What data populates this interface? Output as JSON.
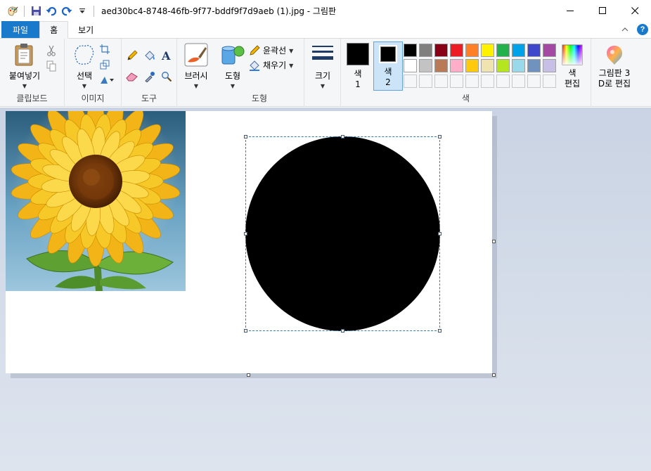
{
  "window": {
    "title": "aed30bc4-8748-46fb-9f77-bddf9f7d9aeb (1).jpg - 그림판"
  },
  "tabs": [
    {
      "label": "파일"
    },
    {
      "label": "홈"
    },
    {
      "label": "보기"
    }
  ],
  "ribbon": {
    "clipboard": {
      "paste_label": "붙여넣기",
      "group_label": "클립보드"
    },
    "image": {
      "select_label": "선택",
      "group_label": "이미지"
    },
    "tools": {
      "group_label": "도구"
    },
    "brushes": {
      "label": "브러시"
    },
    "shapes": {
      "label": "도형",
      "outline_label": "윤곽선",
      "fill_label": "채우기",
      "group_label": "도형"
    },
    "size": {
      "label": "크기"
    },
    "colors": {
      "color1_label": "색\n1",
      "color1_line1": "색",
      "color1_line2": "1",
      "color2_line1": "색",
      "color2_line2": "2",
      "edit_line1": "색",
      "edit_line2": "편집",
      "group_label": "색",
      "color1": "#000000",
      "color2": "#000000",
      "palette_row1": [
        "#000000",
        "#7f7f7f",
        "#880015",
        "#ed1c24",
        "#ff7f27",
        "#fff200",
        "#22b14c",
        "#00a2e8",
        "#3f48cc",
        "#a349a4"
      ],
      "palette_row2": [
        "#ffffff",
        "#c3c3c3",
        "#b97a57",
        "#ffaec9",
        "#ffc90e",
        "#efe4b0",
        "#b5e61d",
        "#99d9ea",
        "#7092be",
        "#c8bfe7"
      ]
    },
    "paint3d": {
      "line1": "그림판 3",
      "line2": "D로 편집"
    }
  },
  "canvas": {
    "image_description_icon": "sunflower-image",
    "shape_fill": "#000000"
  }
}
